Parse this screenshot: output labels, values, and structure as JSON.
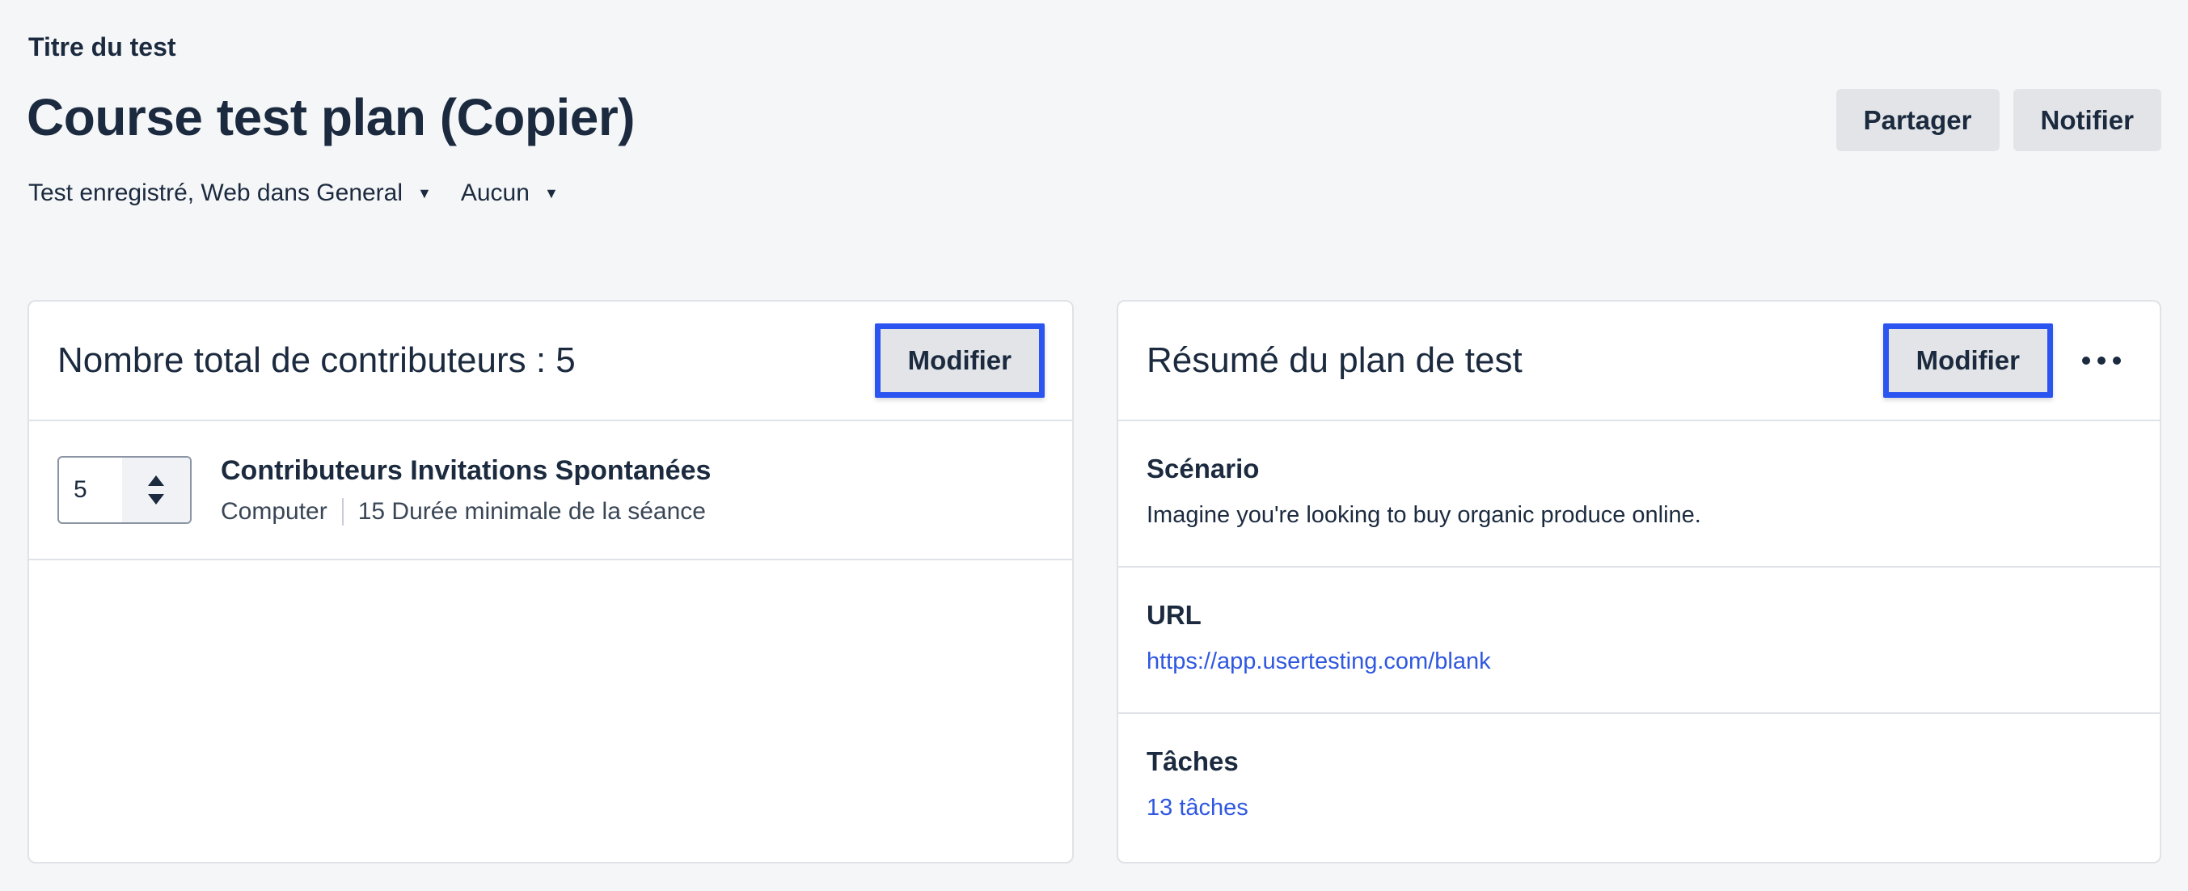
{
  "header": {
    "label": "Titre du test",
    "title": "Course test plan (Copier)",
    "share_label": "Partager",
    "notify_label": "Notifier",
    "test_type": "Test enregistré, Web dans General",
    "folder": "Aucun"
  },
  "contributors_card": {
    "title": "Nombre total de contributeurs : 5",
    "modify_label": "Modifier",
    "stepper_value": "5",
    "audience_title": "Contributeurs Invitations Spontanées",
    "device": "Computer",
    "duration": "15 Durée minimale de la séance"
  },
  "summary_card": {
    "title": "Résumé du plan de test",
    "modify_label": "Modifier",
    "scenario_label": "Scénario",
    "scenario_text": "Imagine you're looking to buy organic produce online.",
    "url_label": "URL",
    "url_value": "https://app.usertesting.com/blank",
    "tasks_label": "Tâches",
    "tasks_value": "13 tâches"
  },
  "colors": {
    "accent": "#2b54f0",
    "link": "#2f57e0",
    "text": "#1b2a3e",
    "background": "#f5f6f8"
  }
}
